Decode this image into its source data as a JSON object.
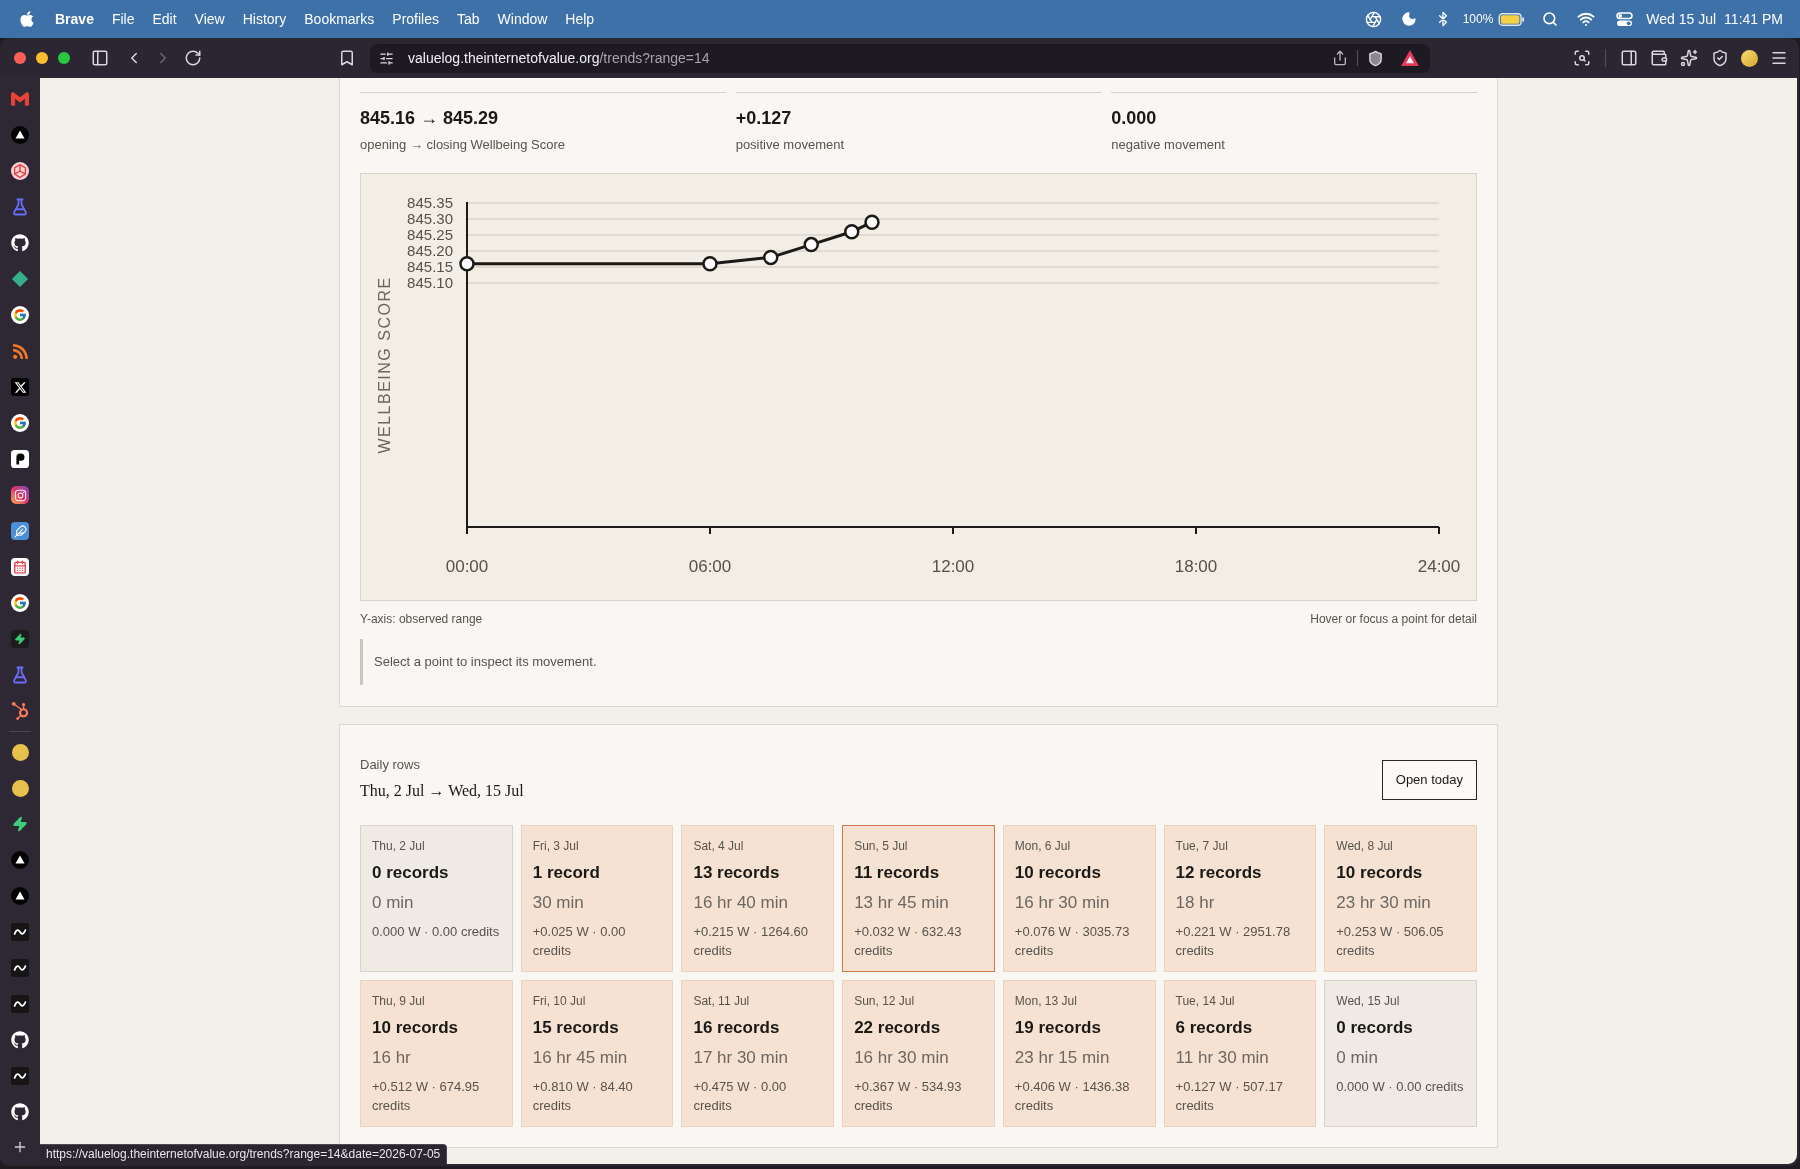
{
  "menu_bar": {
    "app": "Brave",
    "menus": [
      "File",
      "Edit",
      "View",
      "History",
      "Bookmarks",
      "Profiles",
      "Tab",
      "Window",
      "Help"
    ],
    "battery": "100%",
    "date": "Wed 15 Jul",
    "time": "11:41 PM"
  },
  "browser": {
    "back": {
      "disabled": false
    },
    "forward": {
      "disabled": true
    },
    "url": "valuelog.theinternetofvalue.org/trends?range=14",
    "link_preview": "https://valuelog.theinternetofvalue.org/trends?range=14&date=2026-07-05"
  },
  "summary": [
    {
      "value": "845.16 → 845.29",
      "label": "opening → closing Wellbeing Score"
    },
    {
      "value": "+0.127",
      "label": "positive movement"
    },
    {
      "value": "0.000",
      "label": "negative movement"
    }
  ],
  "chart": {
    "chart_data": {
      "type": "line",
      "ylabel": "WELLBEING SCORE",
      "grid": true,
      "x": [
        0,
        6,
        7.5,
        8.5,
        9.5,
        10
      ],
      "series": [
        {
          "color": "#1c1a17",
          "marker": "circle",
          "values": [
            845.16,
            845.16,
            845.18,
            845.22,
            845.26,
            845.29
          ]
        }
      ],
      "xlim": [
        0,
        24
      ],
      "ylim": [
        844.3375,
        845.35
      ],
      "xticks": [
        {
          "value": 0,
          "label": "00:00"
        },
        {
          "value": 6,
          "label": "06:00"
        },
        {
          "value": 12,
          "label": "12:00"
        },
        {
          "value": 18,
          "label": "18:00"
        },
        {
          "value": 24,
          "label": "24:00"
        }
      ],
      "yticks": [
        {
          "value": 845.1,
          "label": "845.10"
        },
        {
          "value": 845.15,
          "label": "845.15"
        },
        {
          "value": 845.2,
          "label": "845.20"
        },
        {
          "value": 845.25,
          "label": "845.25"
        },
        {
          "value": 845.3,
          "label": "845.30"
        },
        {
          "value": 845.35,
          "label": "845.35"
        }
      ]
    },
    "note_left": "Y-axis: observed range",
    "note_right": "Hover or focus a point for detail"
  },
  "detail": "Select a point to inspect its movement.",
  "daily": {
    "eyebrow": "Daily rows",
    "range": "Thu, 2 Jul → Wed, 15 Jul",
    "button": "Open today",
    "days": [
      {
        "date": "Thu, 2 Jul",
        "records": "0 records",
        "duration": "0 min",
        "stats": "0.000 W · 0.00 credits",
        "kind": "empty",
        "selected": false
      },
      {
        "date": "Fri, 3 Jul",
        "records": "1 record",
        "duration": "30 min",
        "stats": "+0.025 W · 0.00 credits",
        "kind": "logged",
        "selected": false
      },
      {
        "date": "Sat, 4 Jul",
        "records": "13 records",
        "duration": "16 hr 40 min",
        "stats": "+0.215 W · 1264.60 credits",
        "kind": "logged",
        "selected": false
      },
      {
        "date": "Sun, 5 Jul",
        "records": "11 records",
        "duration": "13 hr 45 min",
        "stats": "+0.032 W · 632.43 credits",
        "kind": "logged",
        "selected": true
      },
      {
        "date": "Mon, 6 Jul",
        "records": "10 records",
        "duration": "16 hr 30 min",
        "stats": "+0.076 W · 3035.73 credits",
        "kind": "logged",
        "selected": false
      },
      {
        "date": "Tue, 7 Jul",
        "records": "12 records",
        "duration": "18 hr",
        "stats": "+0.221 W · 2951.78 credits",
        "kind": "logged",
        "selected": false
      },
      {
        "date": "Wed, 8 Jul",
        "records": "10 records",
        "duration": "23 hr 30 min",
        "stats": "+0.253 W · 506.05 credits",
        "kind": "logged",
        "selected": false
      },
      {
        "date": "Thu, 9 Jul",
        "records": "10 records",
        "duration": "16 hr",
        "stats": "+0.512 W · 674.95 credits",
        "kind": "logged",
        "selected": false
      },
      {
        "date": "Fri, 10 Jul",
        "records": "15 records",
        "duration": "16 hr 45 min",
        "stats": "+0.810 W · 84.40 credits",
        "kind": "logged",
        "selected": false
      },
      {
        "date": "Sat, 11 Jul",
        "records": "16 records",
        "duration": "17 hr 30 min",
        "stats": "+0.475 W · 0.00 credits",
        "kind": "logged",
        "selected": false
      },
      {
        "date": "Sun, 12 Jul",
        "records": "22 records",
        "duration": "16 hr 30 min",
        "stats": "+0.367 W · 534.93 credits",
        "kind": "logged",
        "selected": false
      },
      {
        "date": "Mon, 13 Jul",
        "records": "19 records",
        "duration": "23 hr 15 min",
        "stats": "+0.406 W · 1436.38 credits",
        "kind": "logged",
        "selected": false
      },
      {
        "date": "Tue, 14 Jul",
        "records": "6 records",
        "duration": "11 hr 30 min",
        "stats": "+0.127 W · 507.17 credits",
        "kind": "logged",
        "selected": false
      },
      {
        "date": "Wed, 15 Jul",
        "records": "0 records",
        "duration": "0 min",
        "stats": "0.000 W · 0.00 credits",
        "kind": "empty",
        "selected": false
      }
    ]
  }
}
